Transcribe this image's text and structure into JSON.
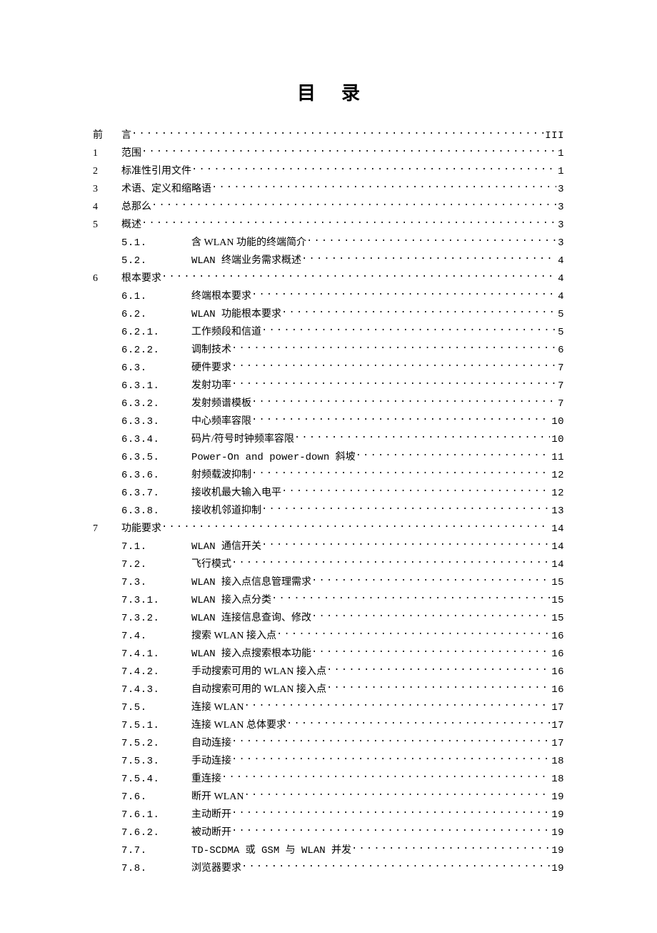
{
  "title": "目录",
  "entries": [
    {
      "num": "前",
      "sub": "",
      "text": "言",
      "page": "III",
      "indent": 0,
      "mono": false
    },
    {
      "num": "1",
      "sub": "",
      "text": "范围",
      "page": "1",
      "indent": 0,
      "mono": false
    },
    {
      "num": "2",
      "sub": "",
      "text": "标准性引用文件",
      "page": "1",
      "indent": 0,
      "mono": false
    },
    {
      "num": "3",
      "sub": "",
      "text": "术语、定义和缩略语",
      "page": "3",
      "indent": 0,
      "mono": false
    },
    {
      "num": "4",
      "sub": "",
      "text": "总那么",
      "page": "3",
      "indent": 0,
      "mono": false
    },
    {
      "num": "5",
      "sub": "",
      "text": "概述",
      "page": "3",
      "indent": 0,
      "mono": false
    },
    {
      "num": "",
      "sub": "5.1.",
      "text": "含 WLAN 功能的终端简介",
      "page": "3",
      "indent": 1,
      "mono": false
    },
    {
      "num": "",
      "sub": "5.2.",
      "text": "WLAN    终端业务需求概述",
      "page": "4",
      "indent": 1,
      "mono": true
    },
    {
      "num": "6",
      "sub": "",
      "text": "根本要求",
      "page": "4",
      "indent": 0,
      "mono": false
    },
    {
      "num": "",
      "sub": "6.1.",
      "text": "终端根本要求",
      "page": "4",
      "indent": 1,
      "mono": false
    },
    {
      "num": "",
      "sub": "6.2.",
      "text": "WLAN 功能根本要求",
      "page": "5",
      "indent": 1,
      "mono": true
    },
    {
      "num": "",
      "sub": "6.2.1.",
      "text": "工作频段和信道",
      "page": "5",
      "indent": 1,
      "mono": false
    },
    {
      "num": "",
      "sub": "6.2.2.",
      "text": "调制技术",
      "page": "6",
      "indent": 1,
      "mono": false
    },
    {
      "num": "",
      "sub": "6.3.",
      "text": "硬件要求",
      "page": "7",
      "indent": 1,
      "mono": false
    },
    {
      "num": "",
      "sub": "6.3.1.",
      "text": "发射功率",
      "page": "7",
      "indent": 1,
      "mono": false
    },
    {
      "num": "",
      "sub": "6.3.2.",
      "text": "发射频谱模板",
      "page": "7",
      "indent": 1,
      "mono": false
    },
    {
      "num": "",
      "sub": "6.3.3.",
      "text": "中心频率容限",
      "page": "10",
      "indent": 1,
      "mono": false
    },
    {
      "num": "",
      "sub": "6.3.4.",
      "text": "码片/符号时钟频率容限",
      "page": "10",
      "indent": 1,
      "mono": false
    },
    {
      "num": "",
      "sub": "6.3.5.",
      "text": "Power-On and power-down 斜坡",
      "page": "11",
      "indent": 1,
      "mono": true
    },
    {
      "num": "",
      "sub": "6.3.6.",
      "text": "射频载波抑制",
      "page": "12",
      "indent": 1,
      "mono": false
    },
    {
      "num": "",
      "sub": "6.3.7.",
      "text": "接收机最大输入电平",
      "page": "12",
      "indent": 1,
      "mono": false
    },
    {
      "num": "",
      "sub": "6.3.8.",
      "text": "接收机邻道抑制",
      "page": "13",
      "indent": 1,
      "mono": false
    },
    {
      "num": "7",
      "sub": "",
      "text": "功能要求",
      "page": "14",
      "indent": 0,
      "mono": false
    },
    {
      "num": "",
      "sub": "7.1.",
      "text": "WLAN 通信开关",
      "page": "14",
      "indent": 1,
      "mono": true
    },
    {
      "num": "",
      "sub": "7.2.",
      "text": "飞行模式",
      "page": "14",
      "indent": 1,
      "mono": false
    },
    {
      "num": "",
      "sub": "7.3.",
      "text": "WLAN 接入点信息管理需求",
      "page": "15",
      "indent": 1,
      "mono": true
    },
    {
      "num": "",
      "sub": "7.3.1.",
      "text": "WLAN 接入点分类",
      "page": "15",
      "indent": 1,
      "mono": true
    },
    {
      "num": "",
      "sub": "7.3.2.",
      "text": "WLAN 连接信息查询、修改",
      "page": "15",
      "indent": 1,
      "mono": true
    },
    {
      "num": "",
      "sub": "7.4.",
      "text": "搜索 WLAN 接入点",
      "page": "16",
      "indent": 1,
      "mono": false
    },
    {
      "num": "",
      "sub": "7.4.1.",
      "text": "WLAN 接入点搜索根本功能",
      "page": "16",
      "indent": 1,
      "mono": true
    },
    {
      "num": "",
      "sub": "7.4.2.",
      "text": "手动搜索可用的 WLAN 接入点",
      "page": "16",
      "indent": 1,
      "mono": false
    },
    {
      "num": "",
      "sub": "7.4.3.",
      "text": "自动搜索可用的 WLAN 接入点",
      "page": "16",
      "indent": 1,
      "mono": false
    },
    {
      "num": "",
      "sub": "7.5.",
      "text": "连接 WLAN",
      "page": "17",
      "indent": 1,
      "mono": false
    },
    {
      "num": "",
      "sub": "7.5.1.",
      "text": "连接 WLAN 总体要求",
      "page": "17",
      "indent": 1,
      "mono": false
    },
    {
      "num": "",
      "sub": "7.5.2.",
      "text": "自动连接",
      "page": "17",
      "indent": 1,
      "mono": false
    },
    {
      "num": "",
      "sub": "7.5.3.",
      "text": "手动连接",
      "page": "18",
      "indent": 1,
      "mono": false
    },
    {
      "num": "",
      "sub": "7.5.4.",
      "text": "重连接",
      "page": "18",
      "indent": 1,
      "mono": false
    },
    {
      "num": "",
      "sub": "7.6.",
      "text": "断开 WLAN",
      "page": "19",
      "indent": 1,
      "mono": false
    },
    {
      "num": "",
      "sub": "7.6.1.",
      "text": "主动断开",
      "page": "19",
      "indent": 1,
      "mono": false
    },
    {
      "num": "",
      "sub": "7.6.2.",
      "text": "被动断开",
      "page": "19",
      "indent": 1,
      "mono": false
    },
    {
      "num": "",
      "sub": "7.7.",
      "text": "TD-SCDMA 或 GSM 与 WLAN  并发",
      "page": "19",
      "indent": 1,
      "mono": true
    },
    {
      "num": "",
      "sub": "7.8.",
      "text": "浏览器要求",
      "page": "19",
      "indent": 1,
      "mono": false
    }
  ]
}
